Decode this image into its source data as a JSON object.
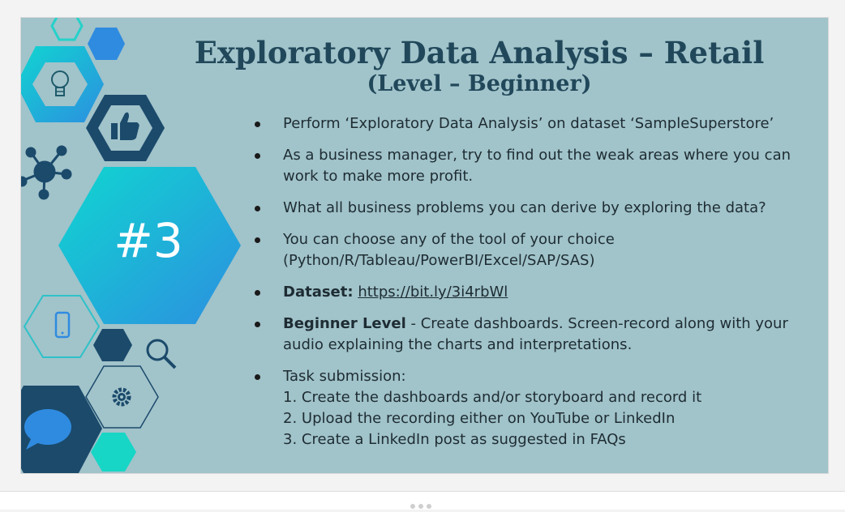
{
  "slide": {
    "title": "Exploratory Data Analysis – Retail",
    "subtitle": "(Level – Beginner)",
    "hex_number": "#3",
    "bullets": [
      {
        "text": "Perform ‘Exploratory Data Analysis’ on dataset  ‘SampleSuperstore’"
      },
      {
        "text": "As a business manager, try to find out the weak areas where you can work to make more profit."
      },
      {
        "text": "What all business problems you can derive by exploring the  data?"
      },
      {
        "text": "You can choose any of the tool of your choice (Python/R/Tableau/PowerBI/Excel/SAP/SAS)"
      },
      {
        "label": "Dataset:",
        "link": "https://bit.ly/3i4rbWl"
      },
      {
        "label": "Beginner Level",
        "text": " - Create dashboards. Screen-record along with your audio explaining the charts and interpretations."
      },
      {
        "text": "Task submission:",
        "lines": [
          "1. Create the dashboards and/or storyboard and record it",
          "2. Upload the recording either on YouTube or LinkedIn",
          "3. Create a LinkedIn post as suggested in FAQs"
        ]
      }
    ]
  },
  "icons": [
    "lightbulb-icon",
    "thumbs-up-icon",
    "network-icon",
    "smartphone-icon",
    "magnifier-icon",
    "gear-icon",
    "chat-bubble-icon"
  ],
  "colors": {
    "slide_bg": "#a1c3ca",
    "title": "#21485a",
    "navy": "#1b4a6b",
    "teal": "#12d3d3",
    "blue": "#2f8be0"
  }
}
